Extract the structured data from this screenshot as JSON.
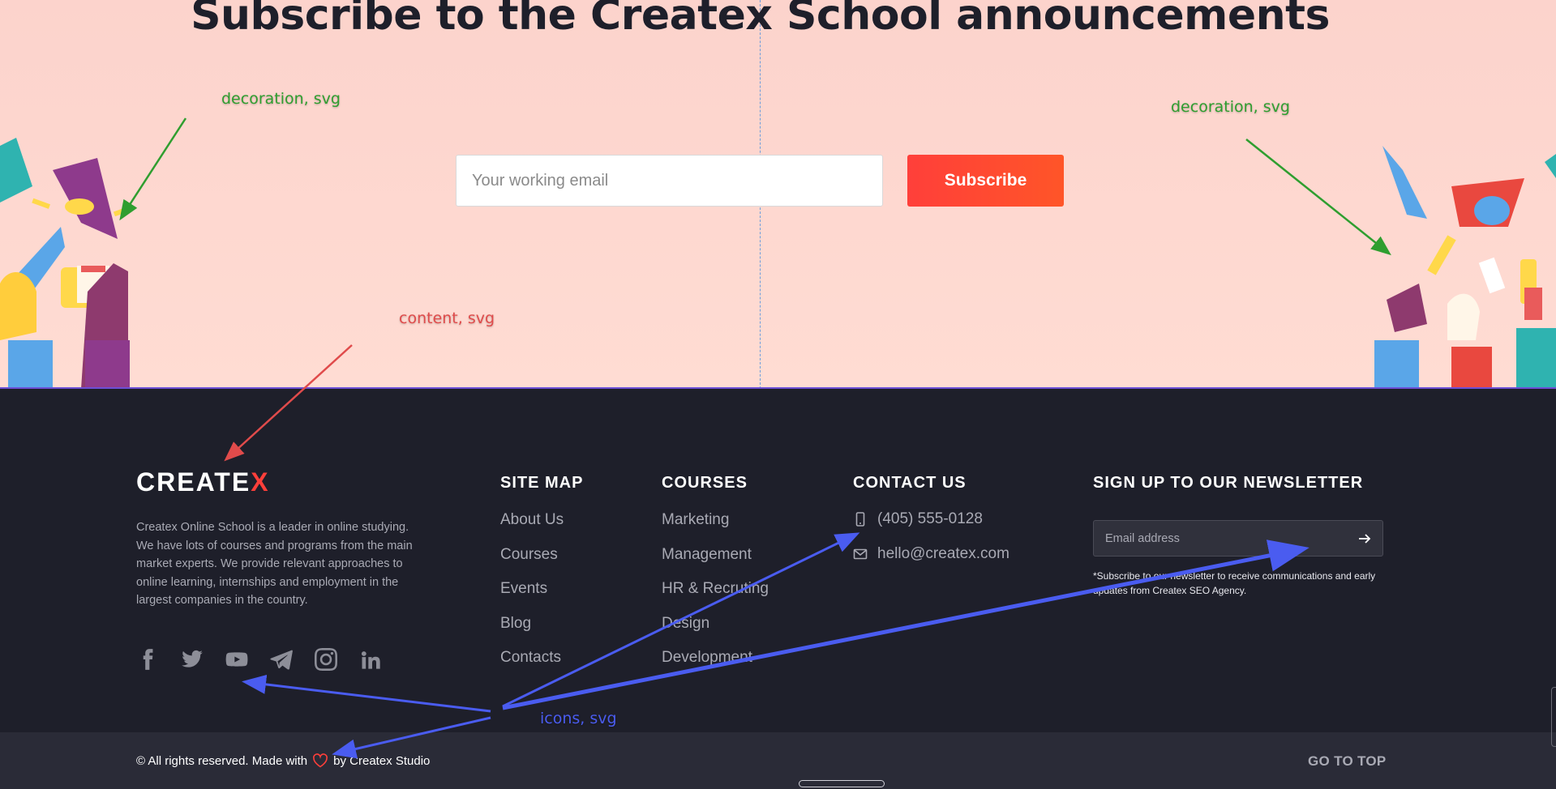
{
  "colors": {
    "accent": "#ff3f3a",
    "footer_bg": "#1e1f2a",
    "subscribe_bg": "#fcd3cc",
    "annotation_green": "#2f9e2f",
    "annotation_red": "#e04b4b",
    "annotation_blue": "#4a5cf0"
  },
  "subscribe": {
    "title": "Subscribe to the Createx School announcements",
    "email_placeholder": "Your working email",
    "button_label": "Subscribe"
  },
  "annotations": {
    "decoration_left": "decoration, svg",
    "decoration_right": "decoration, svg",
    "content": "content, svg",
    "icons": "icons, svg"
  },
  "footer": {
    "logo_main": "CREATE",
    "logo_x": "X",
    "about": "Createx Online School is a leader in online studying. We have lots of courses and programs from the main market experts. We provide relevant approaches to online learning, internships and employment in the largest companies in the country.",
    "socials": [
      "facebook-icon",
      "twitter-icon",
      "youtube-icon",
      "telegram-icon",
      "instagram-icon",
      "linkedin-icon"
    ],
    "sitemap": {
      "title": "SITE MAP",
      "links": [
        "About Us",
        "Courses",
        "Events",
        "Blog",
        "Contacts"
      ]
    },
    "courses": {
      "title": "COURSES",
      "links": [
        "Marketing",
        "Management",
        "HR & Recruting",
        "Design",
        "Development"
      ]
    },
    "contact": {
      "title": "CONTACT US",
      "phone": "(405) 555-0128",
      "email": "hello@createx.com"
    },
    "newsletter": {
      "title": "SIGN UP TO OUR NEWSLETTER",
      "placeholder": "Email address",
      "note": "*Subscribe to our newsletter to receive communications and early updates from Createx SEO Agency."
    }
  },
  "bottom": {
    "copyright_prefix": "© All rights reserved. Made with",
    "copyright_suffix": "by Createx Studio",
    "go_top": "GO TO TOP"
  }
}
